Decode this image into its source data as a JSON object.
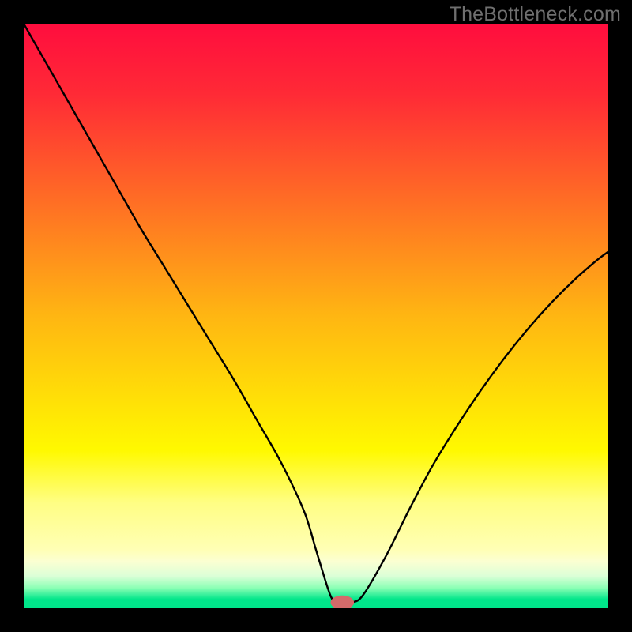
{
  "watermark": "TheBottleneck.com",
  "chart_data": {
    "type": "line",
    "title": "",
    "xlabel": "",
    "ylabel": "",
    "xlim": [
      0,
      100
    ],
    "ylim": [
      0,
      100
    ],
    "grid": false,
    "background_gradient": {
      "stops": [
        {
          "offset": 0.0,
          "color": "#ff0d3e"
        },
        {
          "offset": 0.12,
          "color": "#ff2a36"
        },
        {
          "offset": 0.5,
          "color": "#ffb612"
        },
        {
          "offset": 0.73,
          "color": "#fff900"
        },
        {
          "offset": 0.82,
          "color": "#fffe84"
        },
        {
          "offset": 0.9,
          "color": "#ffffb5"
        },
        {
          "offset": 0.92,
          "color": "#fbffd2"
        },
        {
          "offset": 0.945,
          "color": "#dbffd7"
        },
        {
          "offset": 0.965,
          "color": "#8cffb5"
        },
        {
          "offset": 0.985,
          "color": "#00e68a"
        },
        {
          "offset": 1.0,
          "color": "#00e58a"
        }
      ]
    },
    "series": [
      {
        "name": "bottleneck-curve",
        "color": "#000000",
        "x": [
          0,
          4,
          8,
          12,
          16,
          20,
          24,
          28,
          32,
          36,
          40,
          44,
          48,
          50,
          52,
          53,
          54,
          56,
          58,
          62,
          66,
          70,
          74,
          78,
          82,
          86,
          90,
          94,
          98,
          100
        ],
        "y": [
          100,
          93,
          86,
          79,
          72,
          65,
          58.5,
          52,
          45.5,
          39,
          32,
          25,
          16.5,
          10,
          3.5,
          1.2,
          1.0,
          1.0,
          2.2,
          9,
          17,
          24.5,
          31,
          37,
          42.5,
          47.5,
          52,
          56,
          59.5,
          61
        ]
      }
    ],
    "marker": {
      "name": "optimal-point",
      "x": 54.5,
      "y": 1.0,
      "rx": 2.0,
      "ry": 1.2,
      "color": "#d46a6a"
    }
  }
}
